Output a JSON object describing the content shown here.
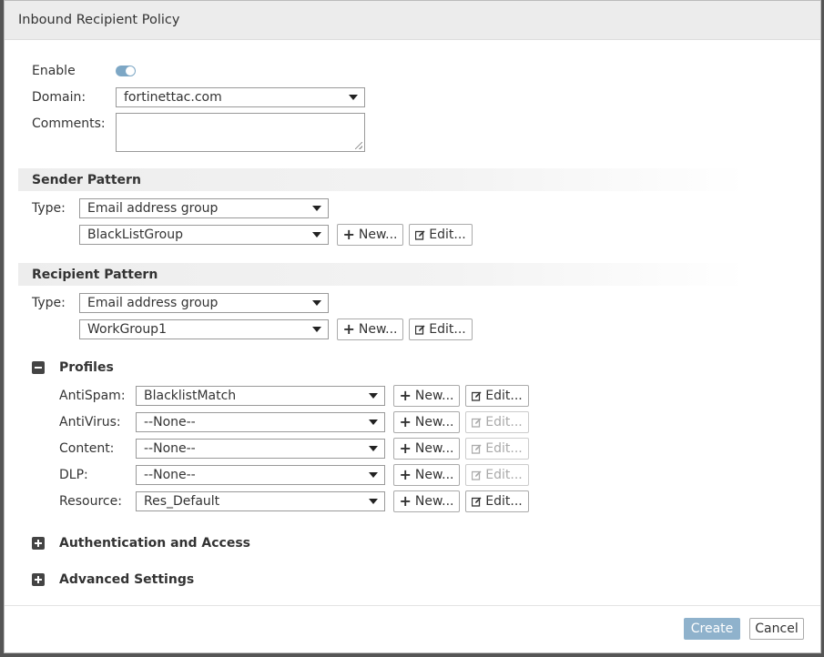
{
  "dialog": {
    "title": "Inbound Recipient Policy"
  },
  "general": {
    "enable_label": "Enable",
    "enable_on": true,
    "domain_label": "Domain:",
    "domain_value": "fortinettac.com",
    "comments_label": "Comments:",
    "comments_value": ""
  },
  "sender": {
    "section_title": "Sender Pattern",
    "type_label": "Type:",
    "type_value": "Email address group",
    "group_value": "BlackListGroup",
    "new_label": "New...",
    "edit_label": "Edit..."
  },
  "recipient": {
    "section_title": "Recipient Pattern",
    "type_label": "Type:",
    "type_value": "Email address group",
    "group_value": "WorkGroup1",
    "new_label": "New...",
    "edit_label": "Edit..."
  },
  "profiles": {
    "title": "Profiles",
    "expanded": true,
    "rows": [
      {
        "label": "AntiSpam:",
        "value": "BlacklistMatch",
        "new_label": "New...",
        "edit_label": "Edit...",
        "edit_enabled": true
      },
      {
        "label": "AntiVirus:",
        "value": "--None--",
        "new_label": "New...",
        "edit_label": "Edit...",
        "edit_enabled": false
      },
      {
        "label": "Content:",
        "value": "--None--",
        "new_label": "New...",
        "edit_label": "Edit...",
        "edit_enabled": false
      },
      {
        "label": "DLP:",
        "value": "--None--",
        "new_label": "New...",
        "edit_label": "Edit...",
        "edit_enabled": false
      },
      {
        "label": "Resource:",
        "value": "Res_Default",
        "new_label": "New...",
        "edit_label": "Edit...",
        "edit_enabled": true
      }
    ]
  },
  "auth": {
    "title": "Authentication and Access",
    "expanded": false
  },
  "advanced": {
    "title": "Advanced Settings",
    "expanded": false
  },
  "footer": {
    "create_label": "Create",
    "cancel_label": "Cancel"
  },
  "colors": {
    "accent": "#8fb2cc",
    "toggle": "#7da7c5",
    "section_bg": "#ededed"
  }
}
